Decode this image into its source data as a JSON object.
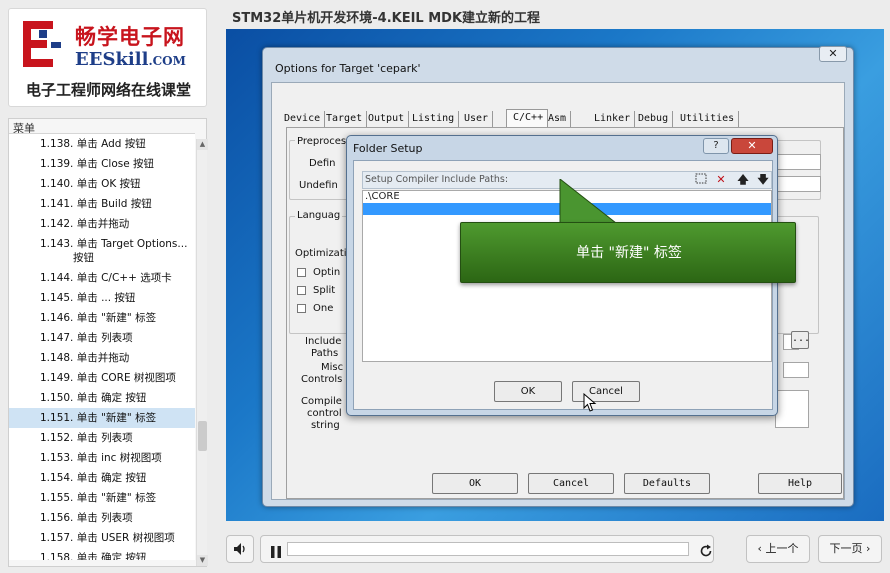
{
  "logo": {
    "cn": "畅学电子网",
    "en": "EESkill",
    "en_suffix": ".COM",
    "tagline": "电子工程师网络在线课堂"
  },
  "page_title": "STM32单片机开发环境-4.KEIL MDK建立新的工程",
  "menu": {
    "title": "菜单",
    "items": [
      {
        "label": "1.138. 单击 Add 按钮",
        "selected": false
      },
      {
        "label": "1.139. 单击 Close 按钮",
        "selected": false
      },
      {
        "label": "1.140. 单击 OK 按钮",
        "selected": false
      },
      {
        "label": "1.141. 单击 Build 按钮",
        "selected": false
      },
      {
        "label": "1.142. 单击并拖动",
        "selected": false
      },
      {
        "label": "1.143. 单击 Target Options...",
        "label2": "按钮",
        "selected": false
      },
      {
        "label": "1.144. 单击 C/C++ 选项卡",
        "selected": false
      },
      {
        "label": "1.145. 单击 ... 按钮",
        "selected": false
      },
      {
        "label": "1.146. 单击 \"新建\" 标签",
        "selected": false
      },
      {
        "label": "1.147. 单击 列表项",
        "selected": false
      },
      {
        "label": "1.148. 单击并拖动",
        "selected": false
      },
      {
        "label": "1.149. 单击 CORE 树视图项",
        "selected": false
      },
      {
        "label": "1.150. 单击 确定 按钮",
        "selected": false
      },
      {
        "label": "1.151. 单击 \"新建\" 标签",
        "selected": true
      },
      {
        "label": "1.152. 单击 列表项",
        "selected": false
      },
      {
        "label": "1.153. 单击 inc 树视图项",
        "selected": false
      },
      {
        "label": "1.154. 单击 确定 按钮",
        "selected": false
      },
      {
        "label": "1.155. 单击 \"新建\" 标签",
        "selected": false
      },
      {
        "label": "1.156. 单击 列表项",
        "selected": false
      },
      {
        "label": "1.157. 单击 USER 树视图项",
        "selected": false
      },
      {
        "label": "1.158. 单击 确定 按钮",
        "selected": false
      }
    ]
  },
  "options_dialog": {
    "title": "Options for Target 'cepark'",
    "close_glyph": "✕",
    "tabs": [
      "Device",
      "Target",
      "Output",
      "Listing",
      "User",
      "C/C++",
      "Asm",
      "Linker",
      "Debug",
      "Utilities"
    ],
    "active_tab": "C/C++",
    "labels": {
      "preproc": "Preprocessor Symbols",
      "define": "Defin",
      "undefine": "Undefin",
      "language": "Languag",
      "optimization": "Optimizati",
      "opt1": "Optin",
      "opt2": "Split",
      "opt3": "One",
      "include1": "Include",
      "include2": "Paths",
      "misc1": "Misc",
      "misc2": "Controls",
      "compiler1": "Compile",
      "compiler2": "control",
      "compiler3": "string",
      "browse": "..."
    },
    "buttons": {
      "ok": "OK",
      "cancel": "Cancel",
      "defaults": "Defaults",
      "help": "Help"
    }
  },
  "folder_dialog": {
    "title": "Folder Setup",
    "help_glyph": "?",
    "close_glyph": "✕",
    "header": "Setup Compiler Include Paths:",
    "paths": [
      ".\\CORE",
      ""
    ],
    "ok": "OK",
    "cancel": "Cancel"
  },
  "callout": {
    "text": "单击 \"新建\" 标签"
  },
  "controls": {
    "prev": "上一个",
    "next": "下一页",
    "progress": 0.0
  }
}
